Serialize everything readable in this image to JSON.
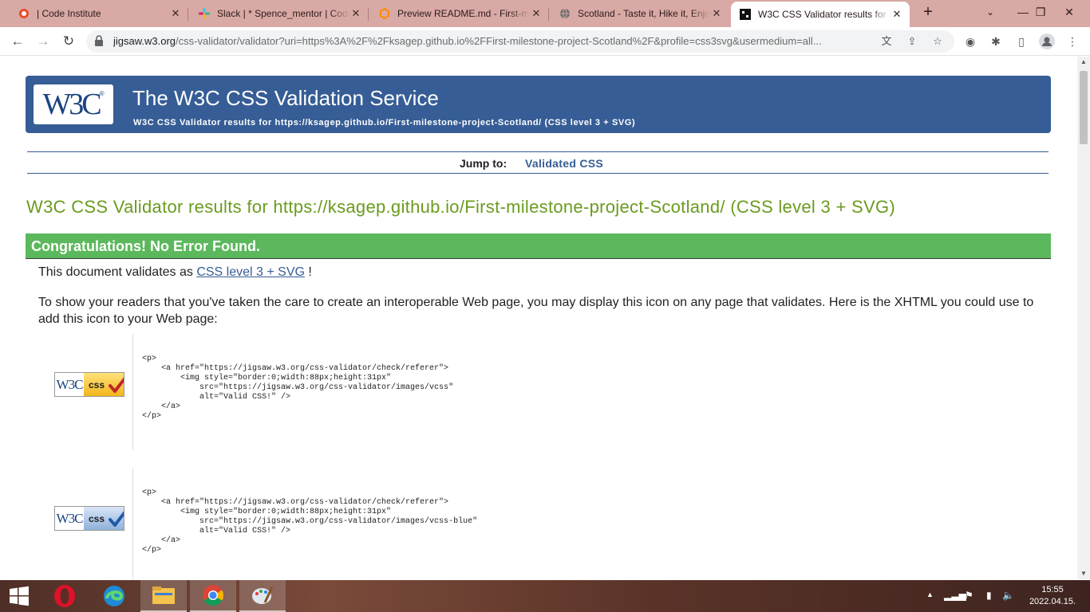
{
  "browser": {
    "tabs": [
      {
        "label": "| Code Institute",
        "icon": "code-institute-icon"
      },
      {
        "label": "Slack | * Spence_mentor | Code",
        "icon": "slack-icon"
      },
      {
        "label": "Preview README.md - First-m",
        "icon": "gitpod-icon"
      },
      {
        "label": "Scotland - Taste it, Hike it, Enjo",
        "icon": "globe-icon"
      },
      {
        "label": "W3C CSS Validator results for h",
        "icon": "w3c-icon"
      }
    ],
    "url_host": "jigsaw.w3.org",
    "url_rest": "/css-validator/validator?uri=https%3A%2F%2Fksagep.github.io%2FFirst-milestone-project-Scotland%2F&profile=css3svg&usermedium=all..."
  },
  "page": {
    "banner_title": "The W3C CSS Validation Service",
    "banner_subtitle": "W3C CSS Validator results for https://ksagep.github.io/First-milestone-project-Scotland/ (CSS level 3 + SVG)",
    "logo_text": "W3C",
    "logo_reg": "®",
    "jump_label": "Jump to:",
    "jump_link": "Validated CSS",
    "results_heading": "W3C CSS Validator results for https://ksagep.github.io/First-milestone-project-Scotland/ (CSS level 3 + SVG)",
    "congrats": "Congratulations! No Error Found.",
    "validates_prefix": "This document validates as",
    "validates_link": "CSS level 3 + SVG",
    "validates_suffix": "!",
    "info": "To show your readers that you've taken the care to create an interoperable Web page, you may display this icon on any page that validates. Here is the XHTML you could use to add this icon to your Web page:",
    "badges": [
      {
        "w3": "W3C",
        "css": "css",
        "color": "#f2b61c",
        "check_color": "#c0262b",
        "code": "<p>\n    <a href=\"https://jigsaw.w3.org/css-validator/check/referer\">\n        <img style=\"border:0;width:88px;height:31px\"\n            src=\"https://jigsaw.w3.org/css-validator/images/vcss\"\n            alt=\"Valid CSS!\" />\n    </a>\n</p>"
      },
      {
        "w3": "W3C",
        "css": "css",
        "color": "#8fb1db",
        "check_color": "#1f5aa6",
        "code": "<p>\n    <a href=\"https://jigsaw.w3.org/css-validator/check/referer\">\n        <img style=\"border:0;width:88px;height:31px\"\n            src=\"https://jigsaw.w3.org/css-validator/images/vcss-blue\"\n            alt=\"Valid CSS!\" />\n    </a>\n</p>"
      }
    ]
  },
  "taskbar": {
    "apps": [
      "windows-start-icon",
      "opera-icon",
      "edge-icon",
      "file-explorer-icon",
      "chrome-icon",
      "paint-icon"
    ],
    "time": "15:55",
    "date": "2022.04.15."
  },
  "colors": {
    "banner": "#365d95",
    "heading_green": "#6b9b1f",
    "congrats_green": "#5cb85c",
    "tabstrip": "#d9a9a5"
  }
}
